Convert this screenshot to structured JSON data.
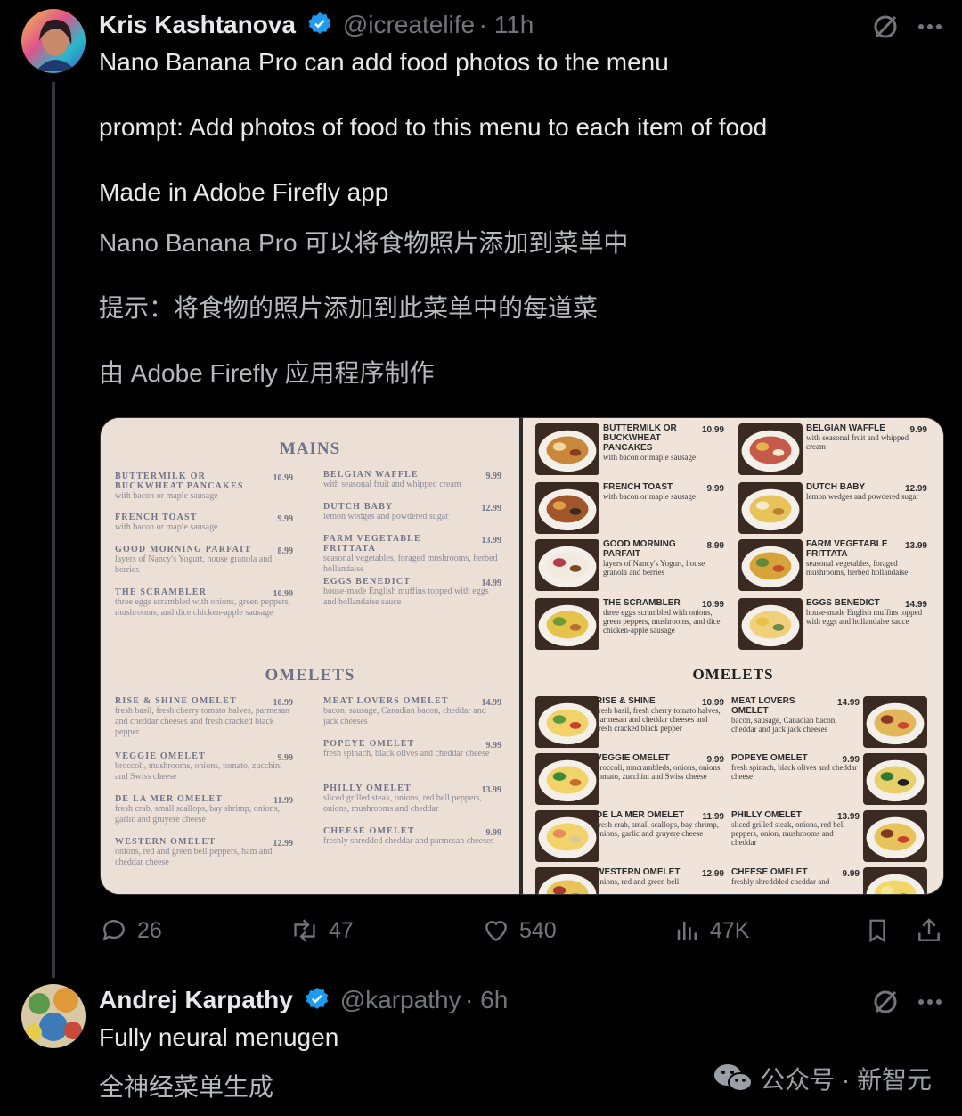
{
  "post1": {
    "author": "Kris Kashtanova",
    "handle": "@icreatelife",
    "time": "· 11h",
    "lines_en": [
      "Nano Banana Pro can add food photos to the menu",
      "prompt: Add photos of food to this menu to each item of food",
      "Made in Adobe Firefly app"
    ],
    "lines_zh": [
      "Nano Banana Pro 可以将食物照片添加到菜单中",
      "提示：将食物的照片添加到此菜单中的每道菜",
      "由 Adobe Firefly 应用程序制作"
    ],
    "actions": {
      "replies": "26",
      "reposts": "47",
      "likes": "540",
      "views": "47K"
    }
  },
  "post2": {
    "author": "Andrej Karpathy",
    "handle": "@karpathy",
    "time": "· 6h",
    "line_en": "Fully neural menugen",
    "line_zh": "全神经菜单生成"
  },
  "watermark": {
    "text": "公众号 · 新智元"
  },
  "menu_left": {
    "mains_title": "MAINS",
    "omelets_title": "OMELETS",
    "mains": [
      {
        "name": "BUTTERMILK OR BUCKWHEAT PANCAKES",
        "price": "10.99",
        "desc": "with bacon or maple sausage"
      },
      {
        "name": "FRENCH TOAST",
        "price": "9.99",
        "desc": "with bacon or maple sausage"
      },
      {
        "name": "GOOD MORNING PARFAIT",
        "price": "8.99",
        "desc": "layers of Nancy's Yogurt, house granola and berries"
      },
      {
        "name": "THE SCRAMBLER",
        "price": "10.99",
        "desc": "three eggs scrambled with onions, green peppers, mushrooms, and dice chicken-apple sausage"
      },
      {
        "name": "BELGIAN WAFFLE",
        "price": "9.99",
        "desc": "with seasonal fruit and whipped cream"
      },
      {
        "name": "DUTCH BABY",
        "price": "12.99",
        "desc": "lemon wedges and powdered sugar"
      },
      {
        "name": "FARM VEGETABLE FRITTATA",
        "price": "13.99",
        "desc": "seasonal vegetables, foraged mushrooms, herbed hollandaise"
      },
      {
        "name": "EGGS BENEDICT",
        "price": "14.99",
        "desc": "house-made English muffins topped with eggs and hollandaise sauce"
      }
    ],
    "omelets": [
      {
        "name": "RISE & SHINE OMELET",
        "price": "10.99",
        "desc": "fresh basil, fresh cherry tomato halves, parmesan and cheddar cheeses and fresh cracked black pepper"
      },
      {
        "name": "VEGGIE OMELET",
        "price": "9.99",
        "desc": "broccoli, mushrooms, onions, tomato, zucchini and Swiss cheese"
      },
      {
        "name": "DE LA MER OMELET",
        "price": "11.99",
        "desc": "fresh crab, small scallops, bay shrimp, onions, garlic and gruyere cheese"
      },
      {
        "name": "WESTERN OMELET",
        "price": "12.99",
        "desc": "onions, red and green bell peppers, ham and cheddar cheese"
      },
      {
        "name": "MEAT LOVERS OMELET",
        "price": "14.99",
        "desc": "bacon, sausage, Canadian bacon, cheddar and jack cheeses"
      },
      {
        "name": "POPEYE OMELET",
        "price": "9.99",
        "desc": "fresh spinach, black olives and cheddar cheese"
      },
      {
        "name": "PHILLY OMELET",
        "price": "13.99",
        "desc": "sliced grilled steak, onions, red bell peppers, onions, mushrooms and cheddar"
      },
      {
        "name": "CHEESE OMELET",
        "price": "9.99",
        "desc": "freshly shredded cheddar and parmesan cheeses"
      }
    ]
  },
  "menu_right": {
    "omelets_title": "OMELETS",
    "mains": [
      {
        "name": "BUTTERMILK OR BUCKWHEAT PANCAKES",
        "price": "10.99",
        "desc": "with bacon or maple sausage"
      },
      {
        "name": "BELGIAN WAFFLE",
        "price": "9.99",
        "desc": "with seasonal fruit and whipped cream"
      },
      {
        "name": "FRENCH TOAST",
        "price": "9.99",
        "desc": "with bacon or maple sausage"
      },
      {
        "name": "DUTCH BABY",
        "price": "12.99",
        "desc": "lemon wedges and powdered sugar"
      },
      {
        "name": "GOOD MORNING PARFAIT",
        "price": "8.99",
        "desc": "layers of Nancy's Yogurt, house granola and berries"
      },
      {
        "name": "FARM VEGETABLE FRITTATA",
        "price": "13.99",
        "desc": "seasonal vegetables, foraged mushrooms, herbed hollandaise"
      },
      {
        "name": "THE SCRAMBLER",
        "price": "10.99",
        "desc": "three eggs scrambled with onions, green peppers, mushrooms, and dice chicken-apple sausage"
      },
      {
        "name": "EGGS BENEDICT",
        "price": "14.99",
        "desc": "house-made English muffins topped with eggs and hollandaise sauce"
      }
    ],
    "omelets": [
      {
        "name": "RISE & SHINE",
        "price": "10.99",
        "desc": "fresh basil, fresh cherry tomato halves, parmesan and cheddar cheeses and fresh cracked black pepper"
      },
      {
        "name": "MEAT LOVERS OMELET",
        "price": "14.99",
        "desc": "bacon, sausage, Canadian bacon, cheddar and jack jack cheeses"
      },
      {
        "name": "VEGGIE OMELET",
        "price": "9.99",
        "desc": "broccoli, mncrambleds, onions, onions, tomato, zucchini and Swiss cheese"
      },
      {
        "name": "POPEYE OMELET",
        "price": "9.99",
        "desc": "fresh spinach, black olives and cheddar cheese"
      },
      {
        "name": "DE LA MER OMELET",
        "price": "11.99",
        "desc": "fresh crab, small scallops, bay shrimp, onions, garlic and gruyere cheese"
      },
      {
        "name": "PHILLY OMELET",
        "price": "13.99",
        "desc": "sliced grilled steak, onions, red bell peppers, onion, mushrooms and cheddar"
      },
      {
        "name": "WESTERN OMELET",
        "price": "12.99",
        "desc": "onions, red and green bell"
      },
      {
        "name": "CHEESE OMELET",
        "price": "9.99",
        "desc": "freshly shreddded cheddar and"
      }
    ]
  },
  "colors": {
    "verified": "#1d9bf0",
    "background": "#000000",
    "muted": "#71767b"
  }
}
